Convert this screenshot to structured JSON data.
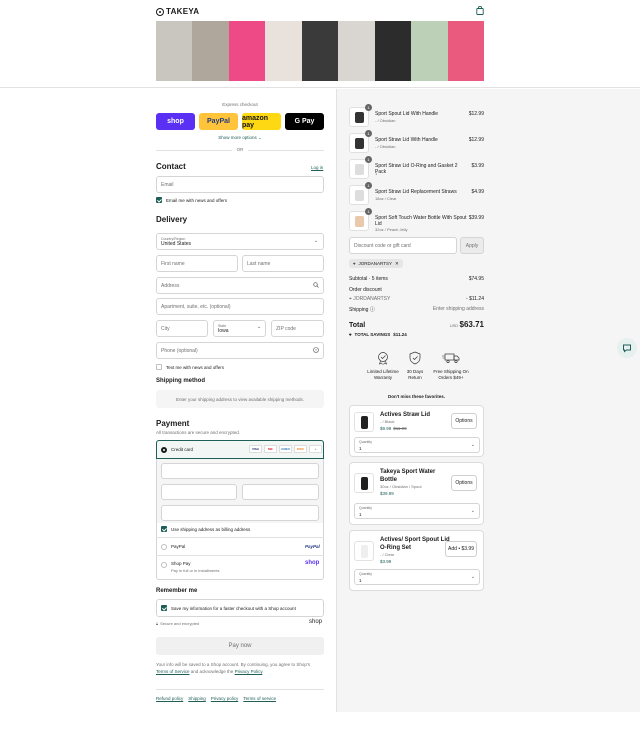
{
  "brand": {
    "logo": "TAKEYA"
  },
  "banner_colors": [
    "#c9c6c0",
    "#b0a79c",
    "#ee4b86",
    "#e8e1dc",
    "#3a3a3a",
    "#d9d5d0",
    "#2d2c2c",
    "#bcd0b7",
    "#ea5a7f"
  ],
  "express": {
    "label": "Express checkout",
    "buttons": [
      {
        "label": "shop",
        "bg": "#5a31f4",
        "fg": "#ffffff"
      },
      {
        "label": "PayPal",
        "bg": "#ffc439",
        "fg": "#253b80"
      },
      {
        "label": "amazon pay",
        "bg": "#ffd814",
        "fg": "#111111"
      },
      {
        "label": "G Pay",
        "bg": "#000000",
        "fg": "#ffffff"
      }
    ],
    "more": "Show more options ⌄",
    "or": "OR"
  },
  "contact": {
    "title": "Contact",
    "login": "Log in",
    "email_placeholder": "Email",
    "news_label": "Email me with news and offers"
  },
  "delivery": {
    "title": "Delivery",
    "country_label": "Country/Region",
    "country_value": "United States",
    "first_name": "First name",
    "last_name": "Last name",
    "address": "Address",
    "apartment": "Apartment, suite, etc. (optional)",
    "city": "City",
    "state_label": "State",
    "state_value": "Iowa",
    "zip": "ZIP code",
    "phone": "Phone (optional)",
    "text_label": "Text me with news and offers"
  },
  "shipping_method": {
    "title": "Shipping method",
    "message": "Enter your shipping address to view available shipping methods."
  },
  "payment": {
    "title": "Payment",
    "subtitle": "All transactions are secure and encrypted.",
    "credit_card": "Credit card",
    "card_brands": [
      "VISA",
      "MC",
      "AMEX",
      "DISC",
      "+"
    ],
    "billing_label": "Use shipping address as billing address",
    "paypal": "PayPal",
    "paypal_logo": "PayPal",
    "shop_pay": "Shop Pay",
    "shop_pay_sub": "Pay in full or in installments",
    "shop_logo": "shop"
  },
  "remember": {
    "title": "Remember me",
    "label": "Save my information for a faster checkout with a Shop account",
    "secure": "Secure and encrypted",
    "shop": "shop"
  },
  "pay_now": "Pay now",
  "legal": {
    "line1": "Your info will be saved to a Shop account. By continuing, you agree to Shop's",
    "terms": "Terms of Service",
    "and_ack": " and acknowledge the ",
    "privacy": "Privacy Policy",
    "period": "."
  },
  "footer_links": [
    "Refund policy",
    "Shipping",
    "Privacy policy",
    "Terms of service"
  ],
  "cart": {
    "items": [
      {
        "qty": "1",
        "name": "Sport Spout Lid With Handle",
        "variant": "- / Obsidian",
        "price": "$12.99"
      },
      {
        "qty": "1",
        "name": "Sport Straw Lid With Handle",
        "variant": "- / Obsidian",
        "price": "$12.99"
      },
      {
        "qty": "1",
        "name": "Sport Straw Lid O-Ring and Gasket 2 Pack",
        "variant": "1",
        "price": "$3.99"
      },
      {
        "qty": "1",
        "name": "Sport Straw Lid Replacement Straws",
        "variant": "18oz / Clear",
        "price": "$4.99"
      },
      {
        "qty": "1",
        "name": "Sport Soft Touch Water Bottle With Spout Lid",
        "variant": "32oz / Peach Jelly",
        "price": "$39.99"
      }
    ],
    "discount_placeholder": "Discount code or gift card",
    "apply": "Apply",
    "code_chip": "JORDANARTSY",
    "subtotal_label": "Subtotal · 5 items",
    "subtotal_value": "$74.95",
    "order_discount_label": "Order discount",
    "discount_code": "JORDANARTSY",
    "discount_value": "- $11.24",
    "shipping_label": "Shipping",
    "shipping_value": "Enter shipping address",
    "total_label": "Total",
    "currency": "USD",
    "total_value": "$63.71",
    "savings_label": "TOTAL SAVINGS",
    "savings_value": "$11.24"
  },
  "badges": [
    {
      "line1": "Limited Lifetime",
      "line2": "Warranty"
    },
    {
      "line1": "30 Days",
      "line2": "Return"
    },
    {
      "line1": "Free Shipping On",
      "line2": "Orders $49+"
    }
  ],
  "favorites_title": "Don't miss these favorites.",
  "recommendations": [
    {
      "title": "Actives Straw Lid",
      "variant": "- / Black",
      "price_new": "$9.99",
      "price_old": "$11.99",
      "button": "Options",
      "qty_label": "Quantity",
      "qty": "1"
    },
    {
      "title": "Takeya Sport Water Bottle",
      "variant": "30oz / Obsidian / Spout",
      "price_new": "$39.99",
      "price_old": "",
      "button": "Options",
      "qty_label": "Quantity",
      "qty": "1"
    },
    {
      "title": "Actives/ Sport Spout Lid O-Ring Set",
      "variant": "- / Clear",
      "price_new": "$3.99",
      "price_old": "",
      "button": "Add • $3.99",
      "qty_label": "Quantity",
      "qty": "1"
    }
  ],
  "colors": {
    "accent": "#1d5e57",
    "chat": "#1d5e57"
  }
}
